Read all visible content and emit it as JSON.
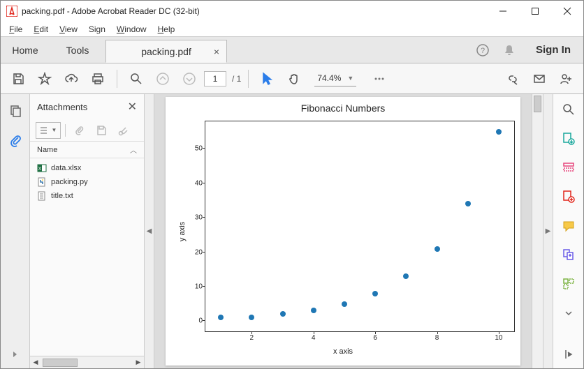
{
  "window": {
    "title": "packing.pdf - Adobe Acrobat Reader DC (32-bit)"
  },
  "menu": {
    "file": "File",
    "edit": "Edit",
    "view": "View",
    "sign": "Sign",
    "window": "Window",
    "help": "Help"
  },
  "tabs": {
    "home": "Home",
    "tools": "Tools",
    "doc": "packing.pdf",
    "signin": "Sign In"
  },
  "toolbar": {
    "page_current": "1",
    "page_total": "/ 1",
    "zoom": "74.4%"
  },
  "attachments": {
    "title": "Attachments",
    "col_name": "Name",
    "files": [
      {
        "name": "data.xlsx",
        "type": "xlsx"
      },
      {
        "name": "packing.py",
        "type": "py"
      },
      {
        "name": "title.txt",
        "type": "txt"
      }
    ]
  },
  "chart_data": {
    "type": "scatter",
    "title": "Fibonacci Numbers",
    "xlabel": "x axis",
    "ylabel": "y axis",
    "xlim": [
      0.5,
      10.5
    ],
    "ylim": [
      -3,
      58
    ],
    "xticks": [
      2,
      4,
      6,
      8,
      10
    ],
    "yticks": [
      0,
      10,
      20,
      30,
      40,
      50
    ],
    "x": [
      1,
      2,
      3,
      4,
      5,
      6,
      7,
      8,
      9,
      10
    ],
    "y": [
      1,
      1,
      2,
      3,
      5,
      8,
      13,
      21,
      34,
      55
    ]
  }
}
